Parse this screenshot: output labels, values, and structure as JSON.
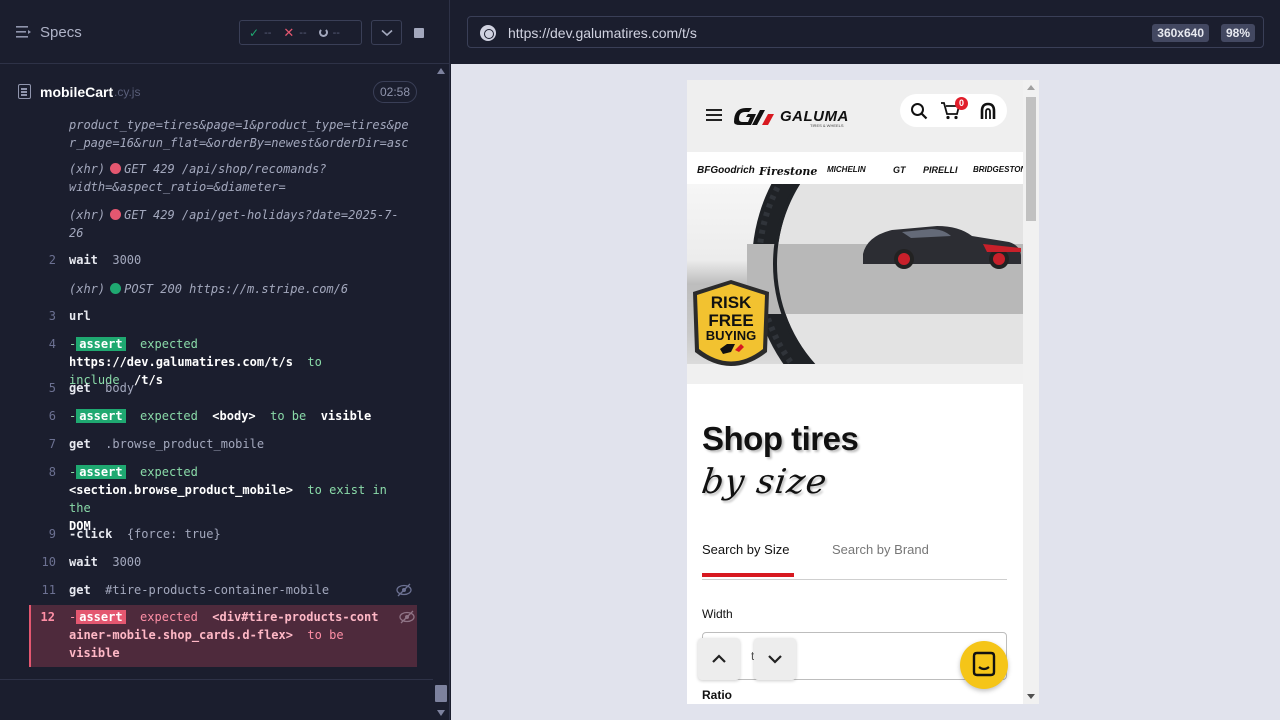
{
  "reporter": {
    "specs_label": "Specs",
    "stats": {
      "passed": "--",
      "failed": "--",
      "pending": "--"
    },
    "spec_name": "mobileCart",
    "spec_ext": ".cy.js",
    "duration": "02:58"
  },
  "log": {
    "xhr1_text": "product_type=tires&page=1&product_type=tires&per_page=16&run_flat=&orderBy=newest&orderDir=asc",
    "xhr_label": "(xhr)",
    "xhr2_text": "GET 429 /api/shop/recomands?width=&aspect_ratio=&diameter=",
    "xhr3_text": "GET 429 /api/get-holidays?date=2025-7-26",
    "cmd2": {
      "num": "2",
      "name": "wait",
      "arg": "3000"
    },
    "xhr4_text": "POST 200 https://m.stripe.com/6",
    "cmd3": {
      "num": "3",
      "name": "url",
      "arg": ""
    },
    "cmd4": {
      "num": "4",
      "badge": "assert",
      "expected": "expected",
      "value": "https://dev.galumatires.com/t/s",
      "op": "to include",
      "target": "/t/s"
    },
    "cmd5": {
      "num": "5",
      "name": "get",
      "arg": "body"
    },
    "cmd6": {
      "num": "6",
      "badge": "assert",
      "expected": "expected",
      "value": "<body>",
      "op": "to be",
      "target": "visible"
    },
    "cmd7": {
      "num": "7",
      "name": "get",
      "arg": ".browse_product_mobile"
    },
    "cmd8": {
      "num": "8",
      "badge": "assert",
      "expected": "expected",
      "value": "<section.browse_product_mobile>",
      "op": "to exist in the",
      "target": "DOM"
    },
    "cmd9": {
      "num": "9",
      "name": "-click",
      "arg": "{force: true}"
    },
    "cmd10": {
      "num": "10",
      "name": "wait",
      "arg": "3000"
    },
    "cmd11": {
      "num": "11",
      "name": "get",
      "arg": "#tire-products-container-mobile"
    },
    "cmd12": {
      "num": "12",
      "badge": "assert",
      "expected": "expected",
      "value": "<div#tire-products-container-mobile.shop_cards.d-flex>",
      "op": "to be",
      "target": "visible"
    }
  },
  "aut": {
    "url": "https://dev.galumatires.com/t/s",
    "viewport": "360x640",
    "zoom": "98%"
  },
  "site": {
    "logo_text": "GALUMA",
    "logo_tagline": "TIRES & WHEELS",
    "cart_count": "0",
    "brands": [
      "BFGoodrich",
      "Firestone",
      "MICHELIN",
      "GT",
      "PIRELLI",
      "BRIDGESTONE"
    ],
    "badge_lines": [
      "RISK",
      "FREE",
      "BUYING"
    ],
    "title": "Shop tires",
    "subtitle": "by size",
    "tab_size": "Search by Size",
    "tab_brand": "Search by Brand",
    "width_label": "Width",
    "width_value": "th",
    "ratio_label": "Ratio"
  },
  "colors": {
    "pass": "#1fa971",
    "fail": "#e45770",
    "accent_red": "#d71920",
    "chat_yellow": "#f5c518"
  },
  "icons": [
    "specs-list-icon",
    "check-icon",
    "x-icon",
    "spinner-icon",
    "chevron-down-icon",
    "stop-icon",
    "document-icon",
    "eye-slash-icon",
    "globe-icon",
    "hamburger-icon",
    "search-icon",
    "cart-icon",
    "user-icon",
    "chevron-up-icon",
    "chat-icon"
  ]
}
